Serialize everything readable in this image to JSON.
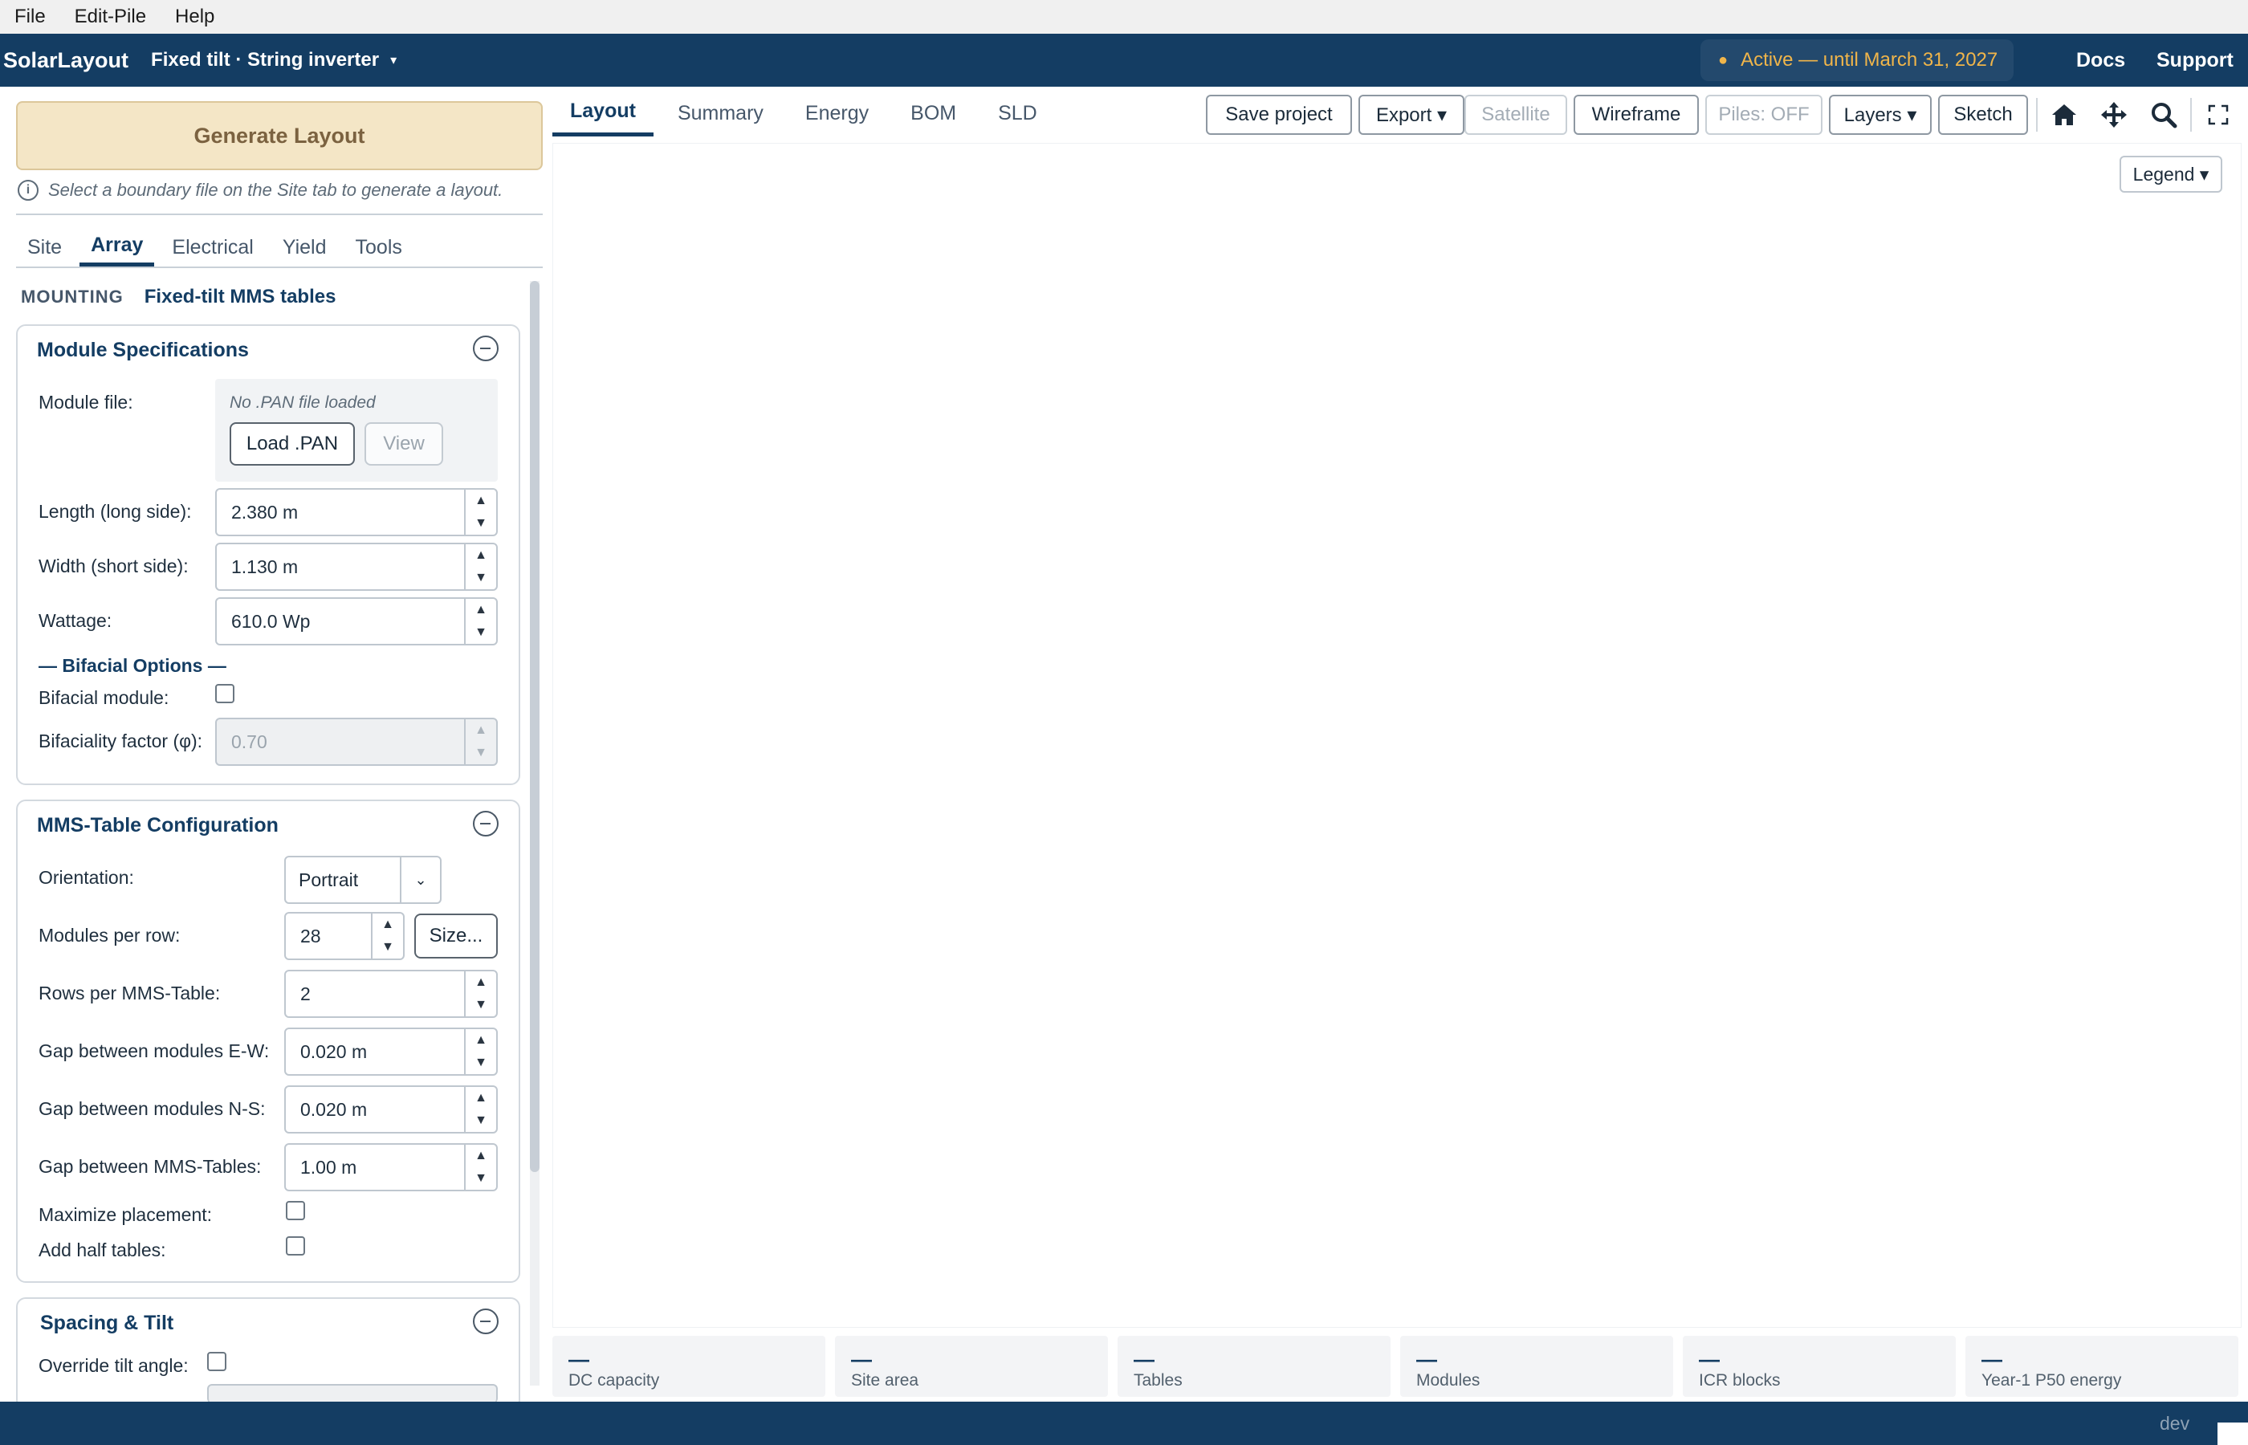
{
  "menu": [
    "File",
    "Edit-Pile",
    "Help"
  ],
  "header": {
    "brand": "SolarLayout",
    "mode": "Fixed tilt · String inverter",
    "mode_caret": "▾",
    "status": "Active — until March 31, 2027",
    "status_dot": "●",
    "links": [
      "Docs",
      "Support"
    ],
    "colors": {
      "bar": "#143d63",
      "status_text": "#f0b54a"
    }
  },
  "left": {
    "generate_label": "Generate Layout",
    "hint": "Select a boundary file on the Site tab to generate a layout.",
    "hint_icon": "i",
    "tabs": [
      "Site",
      "Array",
      "Electrical",
      "Yield",
      "Tools"
    ],
    "active_tab": "Array",
    "mounting_label": "MOUNTING",
    "mounting_value": "Fixed-tilt MMS tables",
    "module": {
      "title": "Module Specifications",
      "file_label": "Module file:",
      "file_status": "No .PAN file loaded",
      "load_button": "Load .PAN",
      "view_button": "View",
      "length_label": "Length (long side):",
      "length_value": "2.380  m",
      "width_label": "Width (short side):",
      "width_value": "1.130  m",
      "wattage_label": "Wattage:",
      "wattage_value": "610.0  Wp",
      "bifacial_heading": "— Bifacial Options —",
      "bifacial_label": "Bifacial module:",
      "bifacial_checked": false,
      "bifaciality_label": "Bifaciality factor (φ):",
      "bifaciality_value": "0.70"
    },
    "mms": {
      "title": "MMS-Table Configuration",
      "orientation_label": "Orientation:",
      "orientation_value": "Portrait",
      "modules_per_row_label": "Modules per row:",
      "modules_per_row_value": "28",
      "size_button": "Size...",
      "rows_label": "Rows per MMS-Table:",
      "rows_value": "2",
      "gap_ew_label": "Gap between modules E-W:",
      "gap_ew_value": "0.020  m",
      "gap_ns_label": "Gap between modules N-S:",
      "gap_ns_value": "0.020  m",
      "gap_tables_label": "Gap between MMS-Tables:",
      "gap_tables_value": "1.00  m",
      "maximize_label": "Maximize placement:",
      "maximize_checked": false,
      "half_label": "Add half tables:",
      "half_checked": false
    },
    "spacing": {
      "title": "Spacing & Tilt",
      "override_label": "Override tilt angle:",
      "override_checked": false
    }
  },
  "main": {
    "tabs": [
      "Layout",
      "Summary",
      "Energy",
      "BOM",
      "SLD"
    ],
    "active_tab": "Layout",
    "toolbar": {
      "save": "Save project",
      "export": "Export ▾",
      "satellite": "Satellite",
      "wireframe": "Wireframe",
      "piles": "Piles: OFF",
      "layers": "Layers ▾",
      "sketch": "Sketch"
    },
    "view_icons": [
      "home-icon",
      "move-icon",
      "search-icon",
      "fullscreen-icon"
    ],
    "legend": "Legend ▾",
    "stats": [
      {
        "value": "—",
        "label": "DC capacity"
      },
      {
        "value": "—",
        "label": "Site area"
      },
      {
        "value": "—",
        "label": "Tables"
      },
      {
        "value": "—",
        "label": "Modules"
      },
      {
        "value": "—",
        "label": "ICR blocks"
      },
      {
        "value": "—",
        "label": "Year-1 P50 energy"
      }
    ]
  },
  "footer": {
    "env": "dev"
  },
  "icons": {
    "spin_up": "▲",
    "spin_down": "▼",
    "select_arrow": "⌄"
  }
}
